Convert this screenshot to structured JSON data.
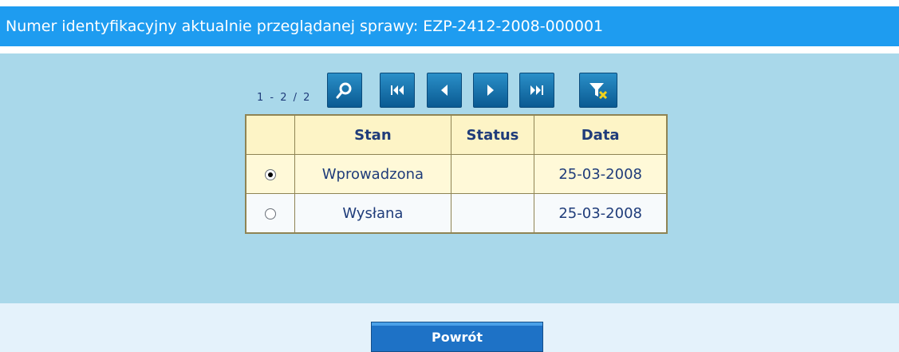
{
  "header": {
    "title": "Numer identyfikacyjny aktualnie przeglądanej sprawy: EZP-2412-2008-000001"
  },
  "pager": {
    "count": "1 - 2 / 2",
    "buttons": [
      {
        "name": "search-button",
        "icon": "search-icon"
      },
      {
        "name": "first-page-button",
        "icon": "first-page-icon"
      },
      {
        "name": "prev-page-button",
        "icon": "prev-icon"
      },
      {
        "name": "next-page-button",
        "icon": "next-icon"
      },
      {
        "name": "last-page-button",
        "icon": "last-page-icon"
      },
      {
        "name": "clear-filter-button",
        "icon": "clear-filter-icon"
      }
    ]
  },
  "table": {
    "columns": [
      "",
      "Stan",
      "Status",
      "Data"
    ],
    "rows": [
      {
        "selected": true,
        "stan": "Wprowadzona",
        "status": "",
        "data": "25-03-2008"
      },
      {
        "selected": false,
        "stan": "Wysłana",
        "status": "",
        "data": "25-03-2008"
      }
    ]
  },
  "footer": {
    "back_label": "Powrót"
  },
  "colors": {
    "header": "#1e9cf0",
    "panel": "#a9d8ea",
    "footer": "#e4f2fb",
    "button": "#1e72c6",
    "table_border": "#8f8454"
  }
}
